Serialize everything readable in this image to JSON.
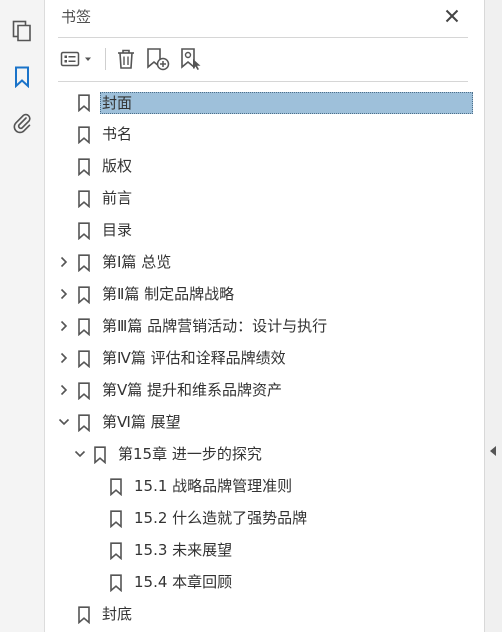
{
  "panel": {
    "title": "书签"
  },
  "rail": {
    "items": [
      {
        "name": "pages-icon"
      },
      {
        "name": "bookmark-icon"
      },
      {
        "name": "attachment-icon"
      }
    ]
  },
  "toolbar": {
    "buttons": [
      "options-menu-icon",
      "delete-icon",
      "new-bookmark-icon",
      "new-bookmark-from-structure-icon"
    ]
  },
  "bookmarks": [
    {
      "label": "封面",
      "level": 0,
      "expander": "none",
      "selected": true
    },
    {
      "label": "书名",
      "level": 0,
      "expander": "none"
    },
    {
      "label": "版权",
      "level": 0,
      "expander": "none"
    },
    {
      "label": "前言",
      "level": 0,
      "expander": "none"
    },
    {
      "label": "目录",
      "level": 0,
      "expander": "none"
    },
    {
      "label": "第Ⅰ篇  总览",
      "level": 0,
      "expander": "collapsed"
    },
    {
      "label": "第Ⅱ篇  制定品牌战略",
      "level": 0,
      "expander": "collapsed"
    },
    {
      "label": "第Ⅲ篇  品牌营销活动：设计与执行",
      "level": 0,
      "expander": "collapsed"
    },
    {
      "label": "第Ⅳ篇  评估和诠释品牌绩效",
      "level": 0,
      "expander": "collapsed"
    },
    {
      "label": "第Ⅴ篇  提升和维系品牌资产",
      "level": 0,
      "expander": "collapsed"
    },
    {
      "label": "第Ⅵ篇  展望",
      "level": 0,
      "expander": "expanded"
    },
    {
      "label": "第15章  进一步的探究",
      "level": 1,
      "expander": "expanded"
    },
    {
      "label": "15.1  战略品牌管理准则",
      "level": 2,
      "expander": "none"
    },
    {
      "label": "15.2  什么造就了强势品牌",
      "level": 2,
      "expander": "none"
    },
    {
      "label": "15.3  未来展望",
      "level": 2,
      "expander": "none"
    },
    {
      "label": "15.4  本章回顾",
      "level": 2,
      "expander": "none"
    },
    {
      "label": "封底",
      "level": 0,
      "expander": "none"
    }
  ],
  "colors": {
    "accent": "#1a73c9",
    "selection": "#9ec0da"
  }
}
